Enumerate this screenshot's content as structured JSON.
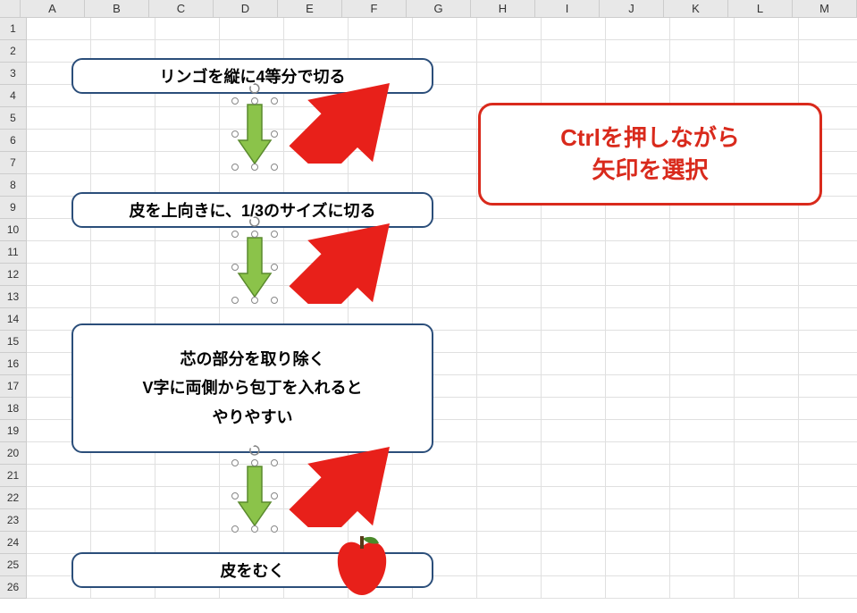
{
  "columns": [
    "A",
    "B",
    "C",
    "D",
    "E",
    "F",
    "G",
    "H",
    "I",
    "J",
    "K",
    "L",
    "M"
  ],
  "row_count": 26,
  "flow": {
    "box1": "リンゴを縦に4等分で切る",
    "box2": "皮を上向きに、1/3のサイズに切る",
    "box3_line1": "芯の部分を取り除く",
    "box3_line2": "V字に両側から包丁を入れると",
    "box3_line3": "やりやすい",
    "box4": "皮をむく"
  },
  "callout": {
    "line1": "Ctrlを押しながら",
    "line2": "矢印を選択"
  },
  "chart_data": {
    "type": "table",
    "title": "Flowchart steps",
    "steps": [
      "リンゴを縦に4等分で切る",
      "皮を上向きに、1/3のサイズに切る",
      "芯の部分を取り除く V字に両側から包丁を入れると やりやすい",
      "皮をむく"
    ]
  }
}
